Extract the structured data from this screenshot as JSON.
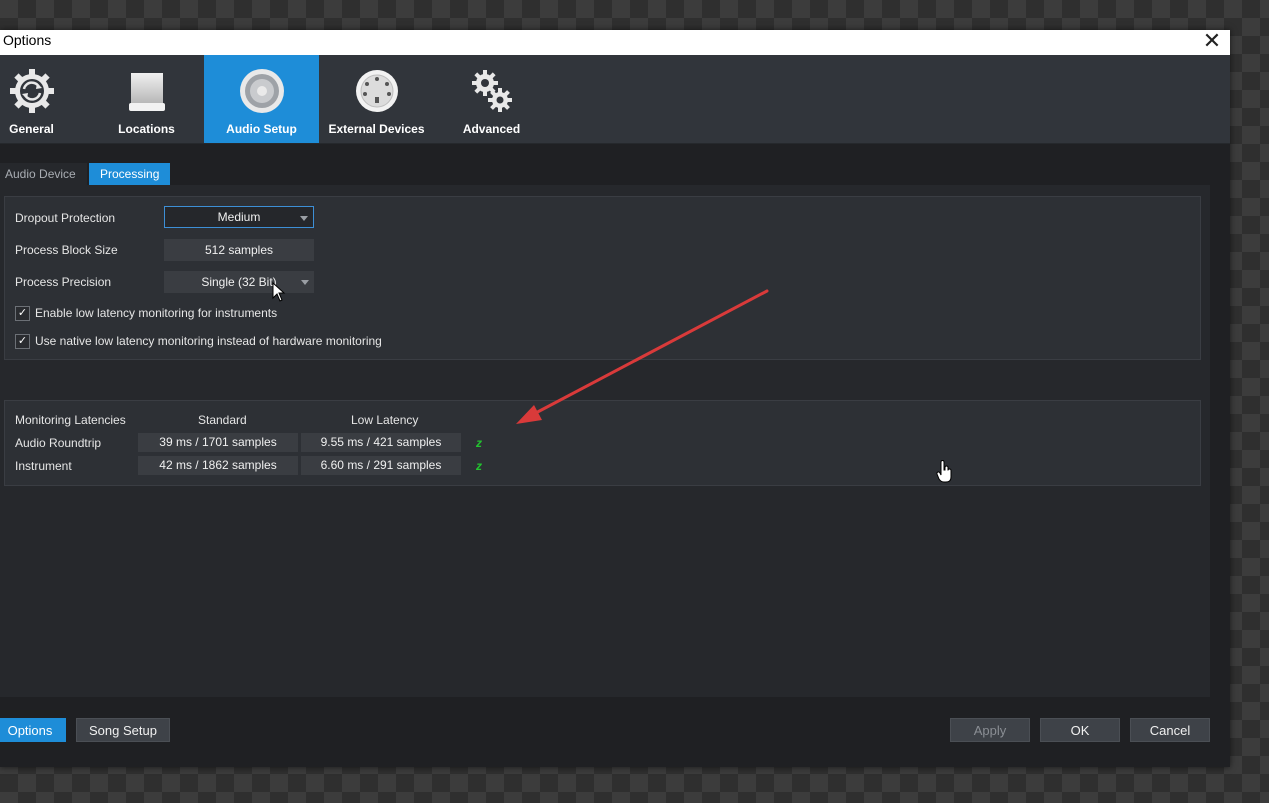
{
  "window": {
    "title": "Options"
  },
  "toolbar": {
    "items": [
      {
        "label": "General",
        "icon": "gear-refresh-icon"
      },
      {
        "label": "Locations",
        "icon": "drive-icon"
      },
      {
        "label": "Audio Setup",
        "icon": "speaker-icon",
        "active": true
      },
      {
        "label": "External Devices",
        "icon": "midi-port-icon"
      },
      {
        "label": "Advanced",
        "icon": "gears-icon"
      }
    ]
  },
  "subtabs": [
    {
      "label": "Audio Device"
    },
    {
      "label": "Processing",
      "active": true
    }
  ],
  "processing": {
    "dropout_protection": {
      "label": "Dropout Protection",
      "value": "Medium"
    },
    "block_size": {
      "label": "Process Block Size",
      "value": "512 samples"
    },
    "precision": {
      "label": "Process Precision",
      "value": "Single (32 Bit)"
    },
    "checkboxes": [
      {
        "label": "Enable low latency monitoring for instruments",
        "checked": true
      },
      {
        "label": "Use native low latency monitoring instead of hardware monitoring",
        "checked": true
      }
    ]
  },
  "latencies": {
    "header": "Monitoring Latencies",
    "col_standard": "Standard",
    "col_low": "Low Latency",
    "rows": [
      {
        "label": "Audio Roundtrip",
        "standard": "39 ms / 1701 samples",
        "low": "9.55 ms / 421 samples",
        "indicator": "z"
      },
      {
        "label": "Instrument",
        "standard": "42 ms / 1862 samples",
        "low": "6.60 ms / 291 samples",
        "indicator": "z"
      }
    ]
  },
  "footer": {
    "options_label": "Options",
    "song_setup_label": "Song Setup",
    "apply_label": "Apply",
    "ok_label": "OK",
    "cancel_label": "Cancel"
  },
  "colors": {
    "accent": "#1e8dd8",
    "annotation_arrow": "#d93a3a",
    "indicator": "#22c32f"
  }
}
